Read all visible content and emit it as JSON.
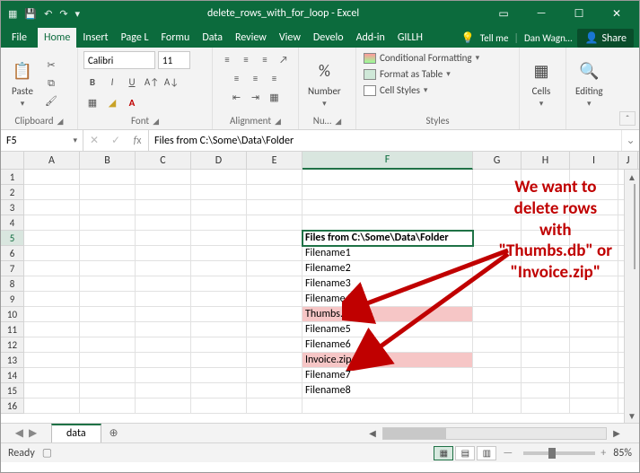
{
  "window": {
    "title": "delete_rows_with_for_loop - Excel",
    "account": "Dan Wagn…",
    "share": "Share",
    "tell_me": "Tell me"
  },
  "tabs": {
    "items": [
      "File",
      "Home",
      "Insert",
      "Page L",
      "Formu",
      "Data",
      "Review",
      "View",
      "Develo",
      "Add-in",
      "GILLH"
    ],
    "active": "Home"
  },
  "ribbon": {
    "clipboard": {
      "paste": "Paste",
      "label": "Clipboard"
    },
    "font": {
      "name": "Calibri",
      "size": "11",
      "label": "Font"
    },
    "alignment": {
      "label": "Alignment"
    },
    "number": {
      "format": "%",
      "button": "Number",
      "label": "Nu…"
    },
    "styles": {
      "cond": "Conditional Formatting",
      "table": "Format as Table",
      "cell": "Cell Styles",
      "label": "Styles"
    },
    "cells": {
      "button": "Cells"
    },
    "editing": {
      "button": "Editing"
    }
  },
  "fxbar": {
    "name": "F5",
    "formula": "Files from C:\\Some\\Data\\Folder"
  },
  "columns": [
    "A",
    "B",
    "C",
    "D",
    "E",
    "F",
    "G",
    "H",
    "I",
    "J"
  ],
  "grid": {
    "f5": "Files from C:\\Some\\Data\\Folder",
    "rows": [
      {
        "r": 6,
        "v": "Filename1"
      },
      {
        "r": 7,
        "v": "Filename2"
      },
      {
        "r": 8,
        "v": "Filename3"
      },
      {
        "r": 9,
        "v": "Filename4"
      },
      {
        "r": 10,
        "v": "Thumbs.db",
        "hl": true
      },
      {
        "r": 11,
        "v": "Filename5"
      },
      {
        "r": 12,
        "v": "Filename6"
      },
      {
        "r": 13,
        "v": "Invoice.zip",
        "hl": true
      },
      {
        "r": 14,
        "v": "Filename7"
      },
      {
        "r": 15,
        "v": "Filename8"
      }
    ]
  },
  "annotation": {
    "line1": "We want to",
    "line2": "delete rows",
    "line3": "with",
    "line4": "\"Thumbs.db\" or",
    "line5": "\"Invoice.zip\""
  },
  "sheet": {
    "active": "data"
  },
  "status": {
    "ready": "Ready",
    "zoom": "85%"
  }
}
